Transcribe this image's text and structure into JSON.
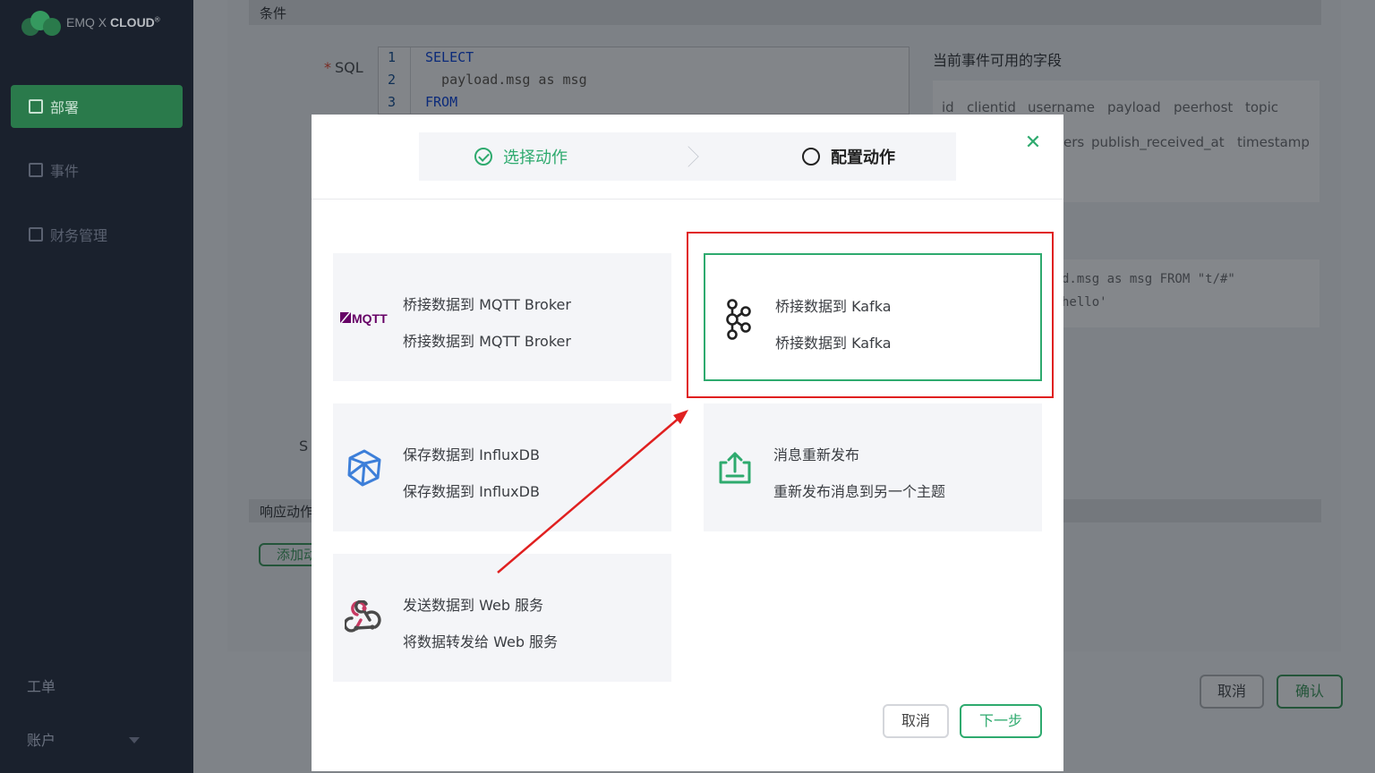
{
  "app": {
    "logo_prefix": "EMQ X ",
    "logo_bold": "CLOUD"
  },
  "sidebar": {
    "items": [
      {
        "label": "部署",
        "active": true
      },
      {
        "label": "事件",
        "active": false
      },
      {
        "label": "财务管理",
        "active": false
      }
    ],
    "bottom": [
      {
        "label": "工单"
      },
      {
        "label": "账户"
      }
    ]
  },
  "background": {
    "condition_label": "条件",
    "sql_label": "SQL",
    "sql_lines": [
      {
        "no": "1",
        "text": "SELECT"
      },
      {
        "no": "2",
        "text": "  payload.msg as msg"
      },
      {
        "no": "3",
        "text": "FROM"
      }
    ],
    "fields_title": "当前事件可用的字段",
    "fields_row1": [
      "id",
      "clientid",
      "username",
      "payload",
      "peerhost",
      "topic"
    ],
    "fields_row2": [
      "ers",
      "publish_received_at",
      "timestamp"
    ],
    "sql_preview_line1": "d.msg as msg FROM \"t/#\"",
    "sql_preview_line2": "hello'",
    "s_letter": "S",
    "response_label": "响应动作",
    "add_button": "添加动",
    "cancel_button": "取消",
    "confirm_button": "确认"
  },
  "modal": {
    "steps": [
      {
        "label": "选择动作",
        "state": "done"
      },
      {
        "label": "配置动作",
        "state": "pending"
      }
    ],
    "close_icon": "close-icon",
    "cards": [
      {
        "title": "桥接数据到 MQTT Broker",
        "desc": "桥接数据到 MQTT Broker",
        "icon": "mqtt-logo",
        "logo_text": "MQTT"
      },
      {
        "title": "桥接数据到 Kafka",
        "desc": "桥接数据到 Kafka",
        "icon": "kafka-icon",
        "selected": true
      },
      {
        "title": "保存数据到 InfluxDB",
        "desc": "保存数据到 InfluxDB",
        "icon": "influxdb-icon"
      },
      {
        "title": "消息重新发布",
        "desc": "重新发布消息到另一个主题",
        "icon": "republish-icon"
      },
      {
        "title": "发送数据到 Web 服务",
        "desc": "将数据转发给 Web 服务",
        "icon": "webhook-icon"
      }
    ],
    "cancel_button": "取消",
    "next_button": "下一步"
  },
  "colors": {
    "brand_green": "#2eaa6e",
    "sidebar_bg": "#1a212d",
    "annotation_red": "#e02020"
  }
}
